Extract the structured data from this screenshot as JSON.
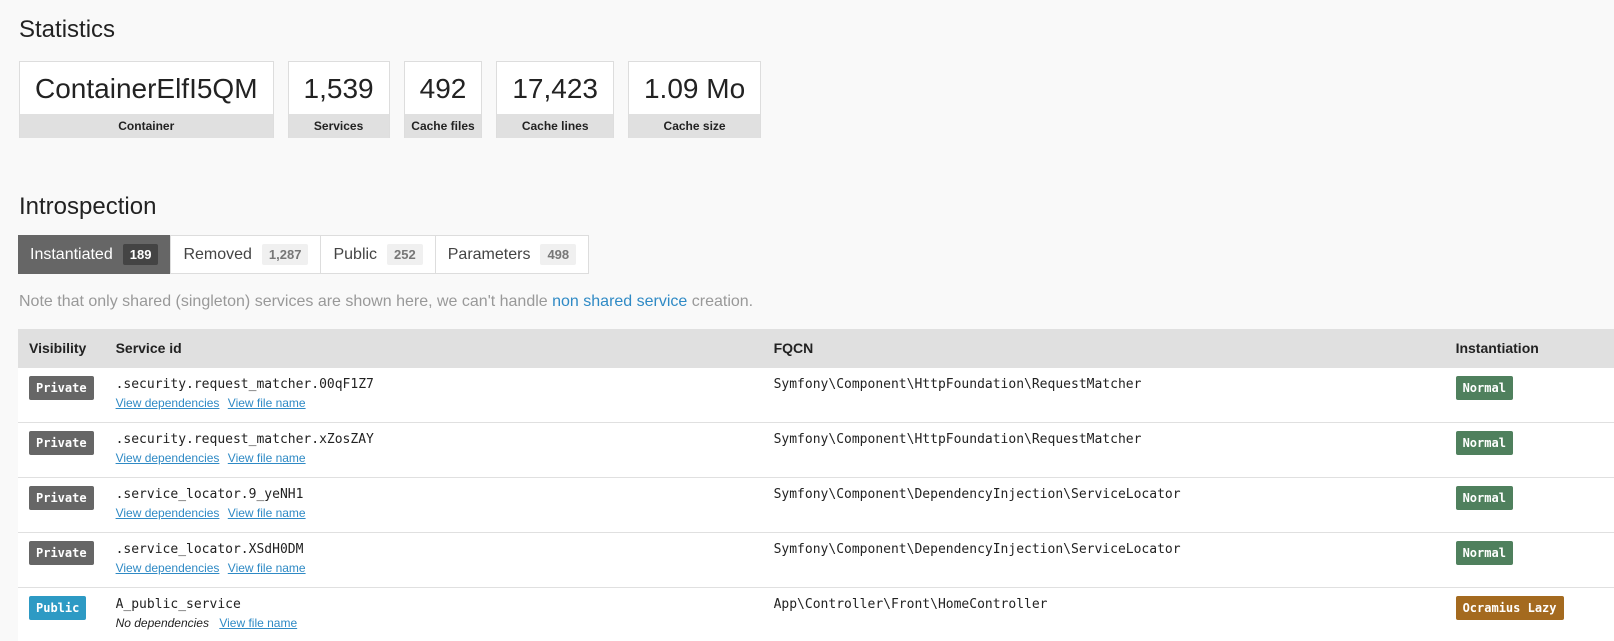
{
  "statistics": {
    "title": "Statistics",
    "metrics": [
      {
        "value": "ContainerElfI5QM",
        "label": "Container"
      },
      {
        "value": "1,539",
        "label": "Services"
      },
      {
        "value": "492",
        "label": "Cache files"
      },
      {
        "value": "17,423",
        "label": "Cache lines"
      },
      {
        "value": "1.09 Mo",
        "label": "Cache size"
      }
    ]
  },
  "introspection": {
    "title": "Introspection",
    "tabs": [
      {
        "label": "Instantiated",
        "count": "189",
        "active": true
      },
      {
        "label": "Removed",
        "count": "1,287",
        "active": false
      },
      {
        "label": "Public",
        "count": "252",
        "active": false
      },
      {
        "label": "Parameters",
        "count": "498",
        "active": false
      }
    ],
    "note": {
      "before": "Note that only shared (singleton) services are shown here, we can't handle ",
      "link": "non shared service",
      "after": " creation."
    }
  },
  "table": {
    "headers": {
      "visibility": "Visibility",
      "service_id": "Service id",
      "fqcn": "FQCN",
      "instantiation": "Instantiation"
    },
    "rows": [
      {
        "visibility": "Private",
        "service_id": ".security.request_matcher.00qF1Z7",
        "deps": "View dependencies",
        "file": "View file name",
        "fqcn": "Symfony\\Component\\HttpFoundation\\RequestMatcher",
        "instantiation": "Normal"
      },
      {
        "visibility": "Private",
        "service_id": ".security.request_matcher.xZosZAY",
        "deps": "View dependencies",
        "file": "View file name",
        "fqcn": "Symfony\\Component\\HttpFoundation\\RequestMatcher",
        "instantiation": "Normal"
      },
      {
        "visibility": "Private",
        "service_id": ".service_locator.9_yeNH1",
        "deps": "View dependencies",
        "file": "View file name",
        "fqcn": "Symfony\\Component\\DependencyInjection\\ServiceLocator",
        "instantiation": "Normal"
      },
      {
        "visibility": "Private",
        "service_id": ".service_locator.XSdH0DM",
        "deps": "View dependencies",
        "file": "View file name",
        "fqcn": "Symfony\\Component\\DependencyInjection\\ServiceLocator",
        "instantiation": "Normal"
      },
      {
        "visibility": "Public",
        "service_id": "A_public_service",
        "no_deps": "No dependencies",
        "file": "View file name",
        "fqcn": "App\\Controller\\Front\\HomeController",
        "instantiation": "Ocramius Lazy"
      }
    ]
  },
  "colors": {
    "private": "#666666",
    "public": "#2d9ac4",
    "normal": "#4f805d",
    "lazy": "#a46a1f",
    "link": "#2f8ac5"
  }
}
